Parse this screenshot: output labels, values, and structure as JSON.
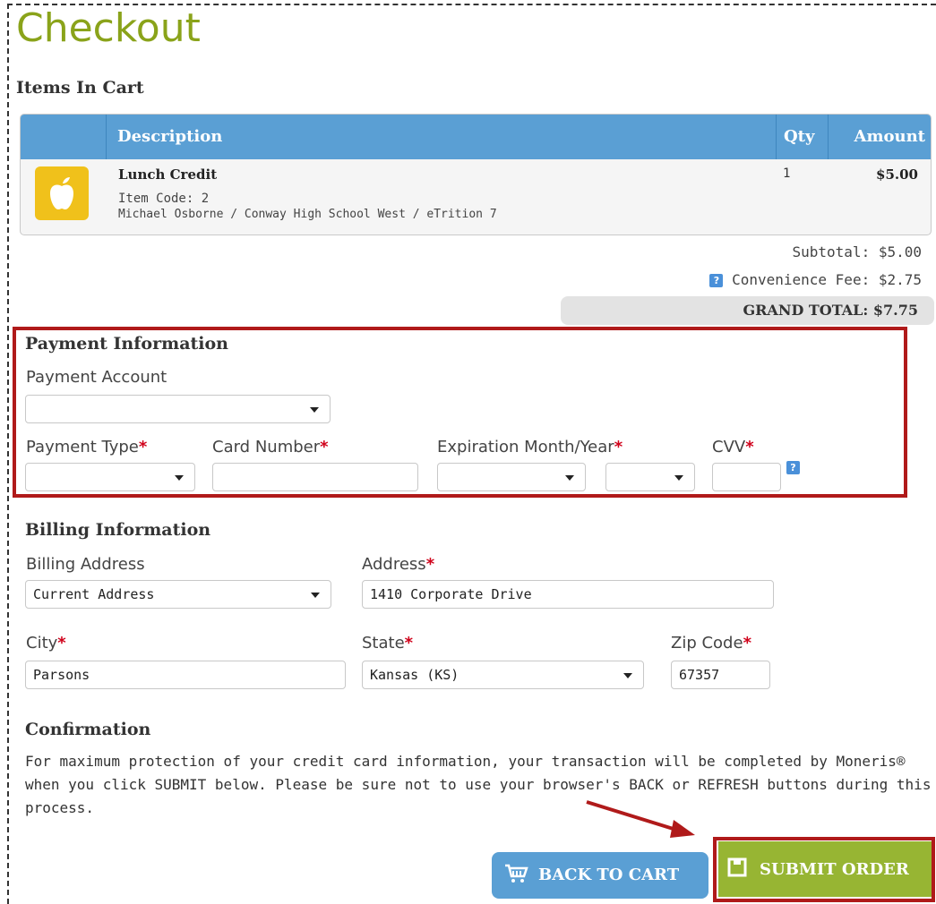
{
  "page": {
    "title": "Checkout"
  },
  "cart": {
    "section_title": "Items In Cart",
    "columns": {
      "description": "Description",
      "qty": "Qty",
      "amount": "Amount"
    },
    "item": {
      "icon": "apple-icon",
      "name": "Lunch Credit",
      "code": "Item Code: 2",
      "details": "Michael Osborne / Conway High School West / eTrition 7",
      "qty": "1",
      "amount": "$5.00"
    }
  },
  "totals": {
    "subtotal": "Subtotal: $5.00",
    "fee": "Convenience Fee: $2.75",
    "grand_total": "GRAND TOTAL: $7.75"
  },
  "payment": {
    "section_title": "Payment Information",
    "account_label": "Payment Account",
    "account_value": "",
    "type_label": "Payment Type",
    "card_label": "Card Number",
    "exp_label": "Expiration Month/Year",
    "cvv_label": "CVV",
    "required_mark": "*",
    "help_glyph": "?"
  },
  "billing": {
    "section_title": "Billing Information",
    "address_select_label": "Billing Address",
    "address_select_value": "Current Address",
    "address_label": "Address",
    "address_value": "1410 Corporate Drive",
    "city_label": "City",
    "city_value": "Parsons",
    "state_label": "State",
    "state_value": "Kansas (KS)",
    "zip_label": "Zip Code",
    "zip_value": "67357"
  },
  "confirmation": {
    "section_title": "Confirmation",
    "text": "For maximum protection of your credit card information, your transaction will be completed by Moneris® when you click SUBMIT below. Please be sure not to use your browser's BACK or REFRESH buttons during this process."
  },
  "actions": {
    "back_label": "BACK TO CART",
    "submit_label": "SUBMIT ORDER"
  },
  "colors": {
    "title_green": "#8aa31a",
    "header_blue": "#5a9fd4",
    "highlight_red": "#b01a1a",
    "submit_green": "#97b533",
    "apple_yellow": "#f0c11b"
  }
}
